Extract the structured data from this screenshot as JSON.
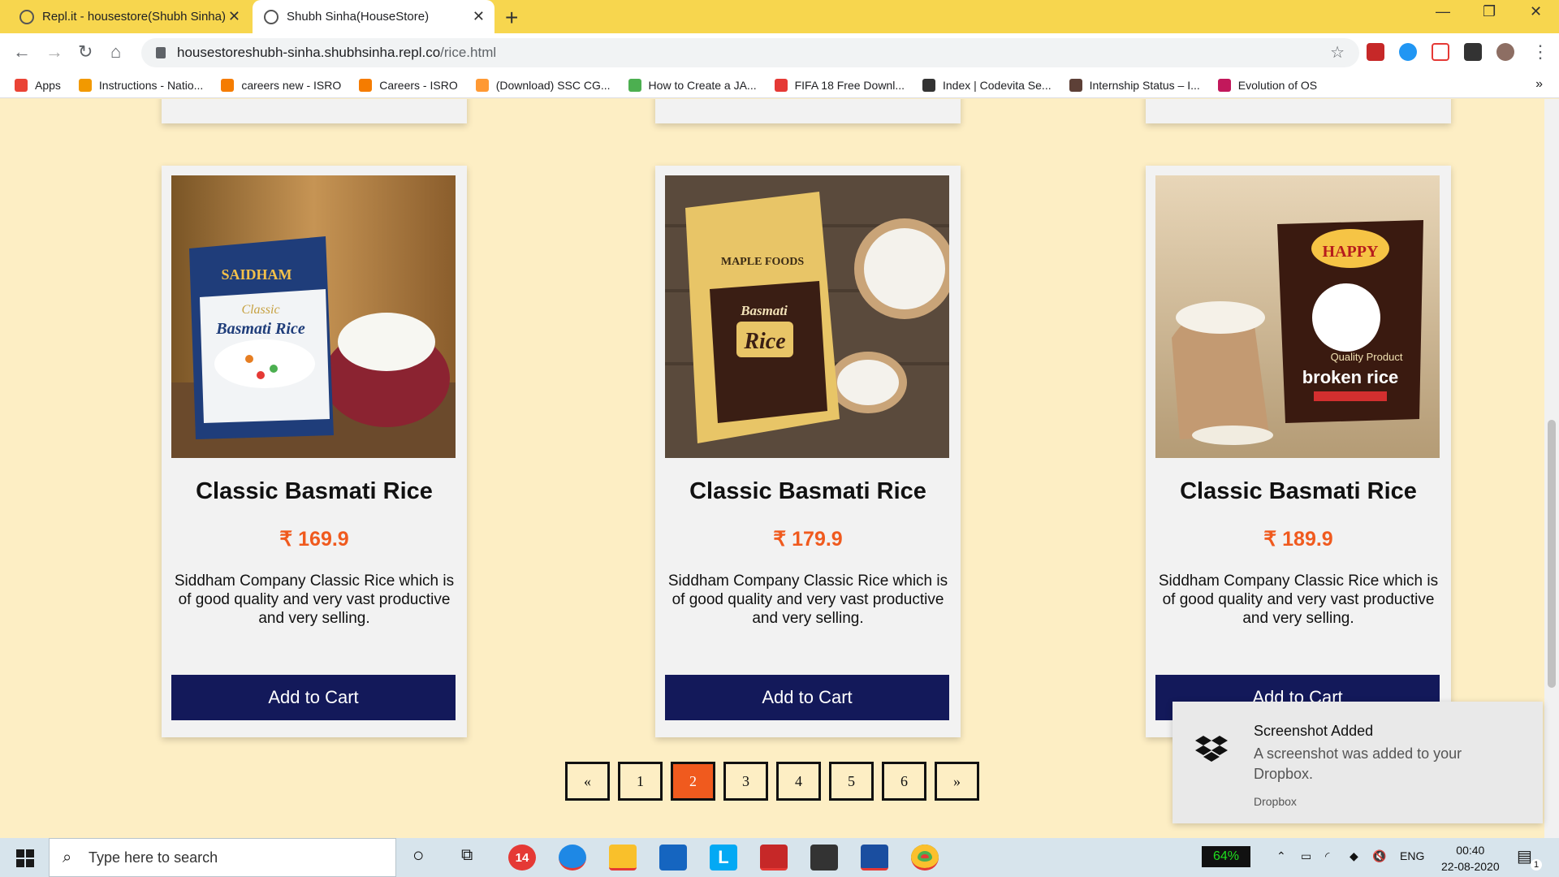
{
  "browser": {
    "tabs": [
      {
        "title": "Repl.it - housestore(Shubh Sinha)",
        "close": "✕"
      },
      {
        "title": "Shubh Sinha(HouseStore)",
        "close": "✕"
      }
    ],
    "new_tab": "+",
    "window_controls": {
      "minimize": "—",
      "restore": "❐",
      "close": "✕"
    },
    "address": {
      "host": "housestoreshubh-sinha.shubhsinha.repl.co",
      "path": "/rice.html"
    },
    "bookmarks": [
      {
        "label": "Apps",
        "icon": "apps-grid-icon",
        "color": "#ea4335"
      },
      {
        "label": "Instructions - Natio...",
        "icon": "bulb-icon",
        "color": "#f29900"
      },
      {
        "label": "careers new - ISRO",
        "icon": "isro-icon",
        "color": "#f57c00"
      },
      {
        "label": "Careers - ISRO",
        "icon": "isro-icon",
        "color": "#f57c00"
      },
      {
        "label": "(Download) SSC CG...",
        "icon": "india-flag-icon",
        "color": "#ff9933"
      },
      {
        "label": "How to Create a JA...",
        "icon": "globe-icon",
        "color": "#4caf50"
      },
      {
        "label": "FIFA 18 Free Downl...",
        "icon": "gamepad-icon",
        "color": "#e53935"
      },
      {
        "label": "Index | Codevita Se...",
        "icon": "globe-icon",
        "color": "#333333"
      },
      {
        "label": "Internship Status – I...",
        "icon": "circle-icon",
        "color": "#5d4037"
      },
      {
        "label": "Evolution of OS",
        "icon": "square-icon",
        "color": "#c2185b"
      }
    ],
    "bookmarks_more": "»"
  },
  "products": [
    {
      "title": "Classic Basmati Rice",
      "price": "₹ 169.9",
      "description": "Siddham Company Classic Rice which is of good quality and very vast productive and very selling.",
      "button": "Add to Cart",
      "brand_lines": [
        "SAIDHAM",
        "Classic",
        "Basmati Rice"
      ]
    },
    {
      "title": "Classic Basmati Rice",
      "price": "₹ 179.9",
      "description": "Siddham Company Classic Rice which is of good quality and very vast productive and very selling.",
      "button": "Add to Cart",
      "brand_lines": [
        "MAPLE FOODS",
        "Basmati",
        "Rice"
      ]
    },
    {
      "title": "Classic Basmati Rice",
      "price": "₹ 189.9",
      "description": "Siddham Company Classic Rice which is of good quality and very vast productive and very selling.",
      "button": "Add to Cart",
      "brand_lines": [
        "HAPPY",
        "Quality Product",
        "broken rice"
      ]
    }
  ],
  "pagination": {
    "prev": "«",
    "pages": [
      "1",
      "2",
      "3",
      "4",
      "5",
      "6"
    ],
    "active": "2",
    "next": "»"
  },
  "toast": {
    "title": "Screenshot Added",
    "body": "A screenshot was added to your Dropbox.",
    "source": "Dropbox"
  },
  "taskbar": {
    "search_placeholder": "Type here to search",
    "battery": "64%",
    "language": "ENG",
    "time": "00:40",
    "date": "22-08-2020",
    "mail_badge": "14",
    "notification_count": "1"
  },
  "colors": {
    "accent": "#f05a1e",
    "button": "#13195a",
    "page_bg": "#fdeec4",
    "tabstrip": "#f7d64e"
  }
}
